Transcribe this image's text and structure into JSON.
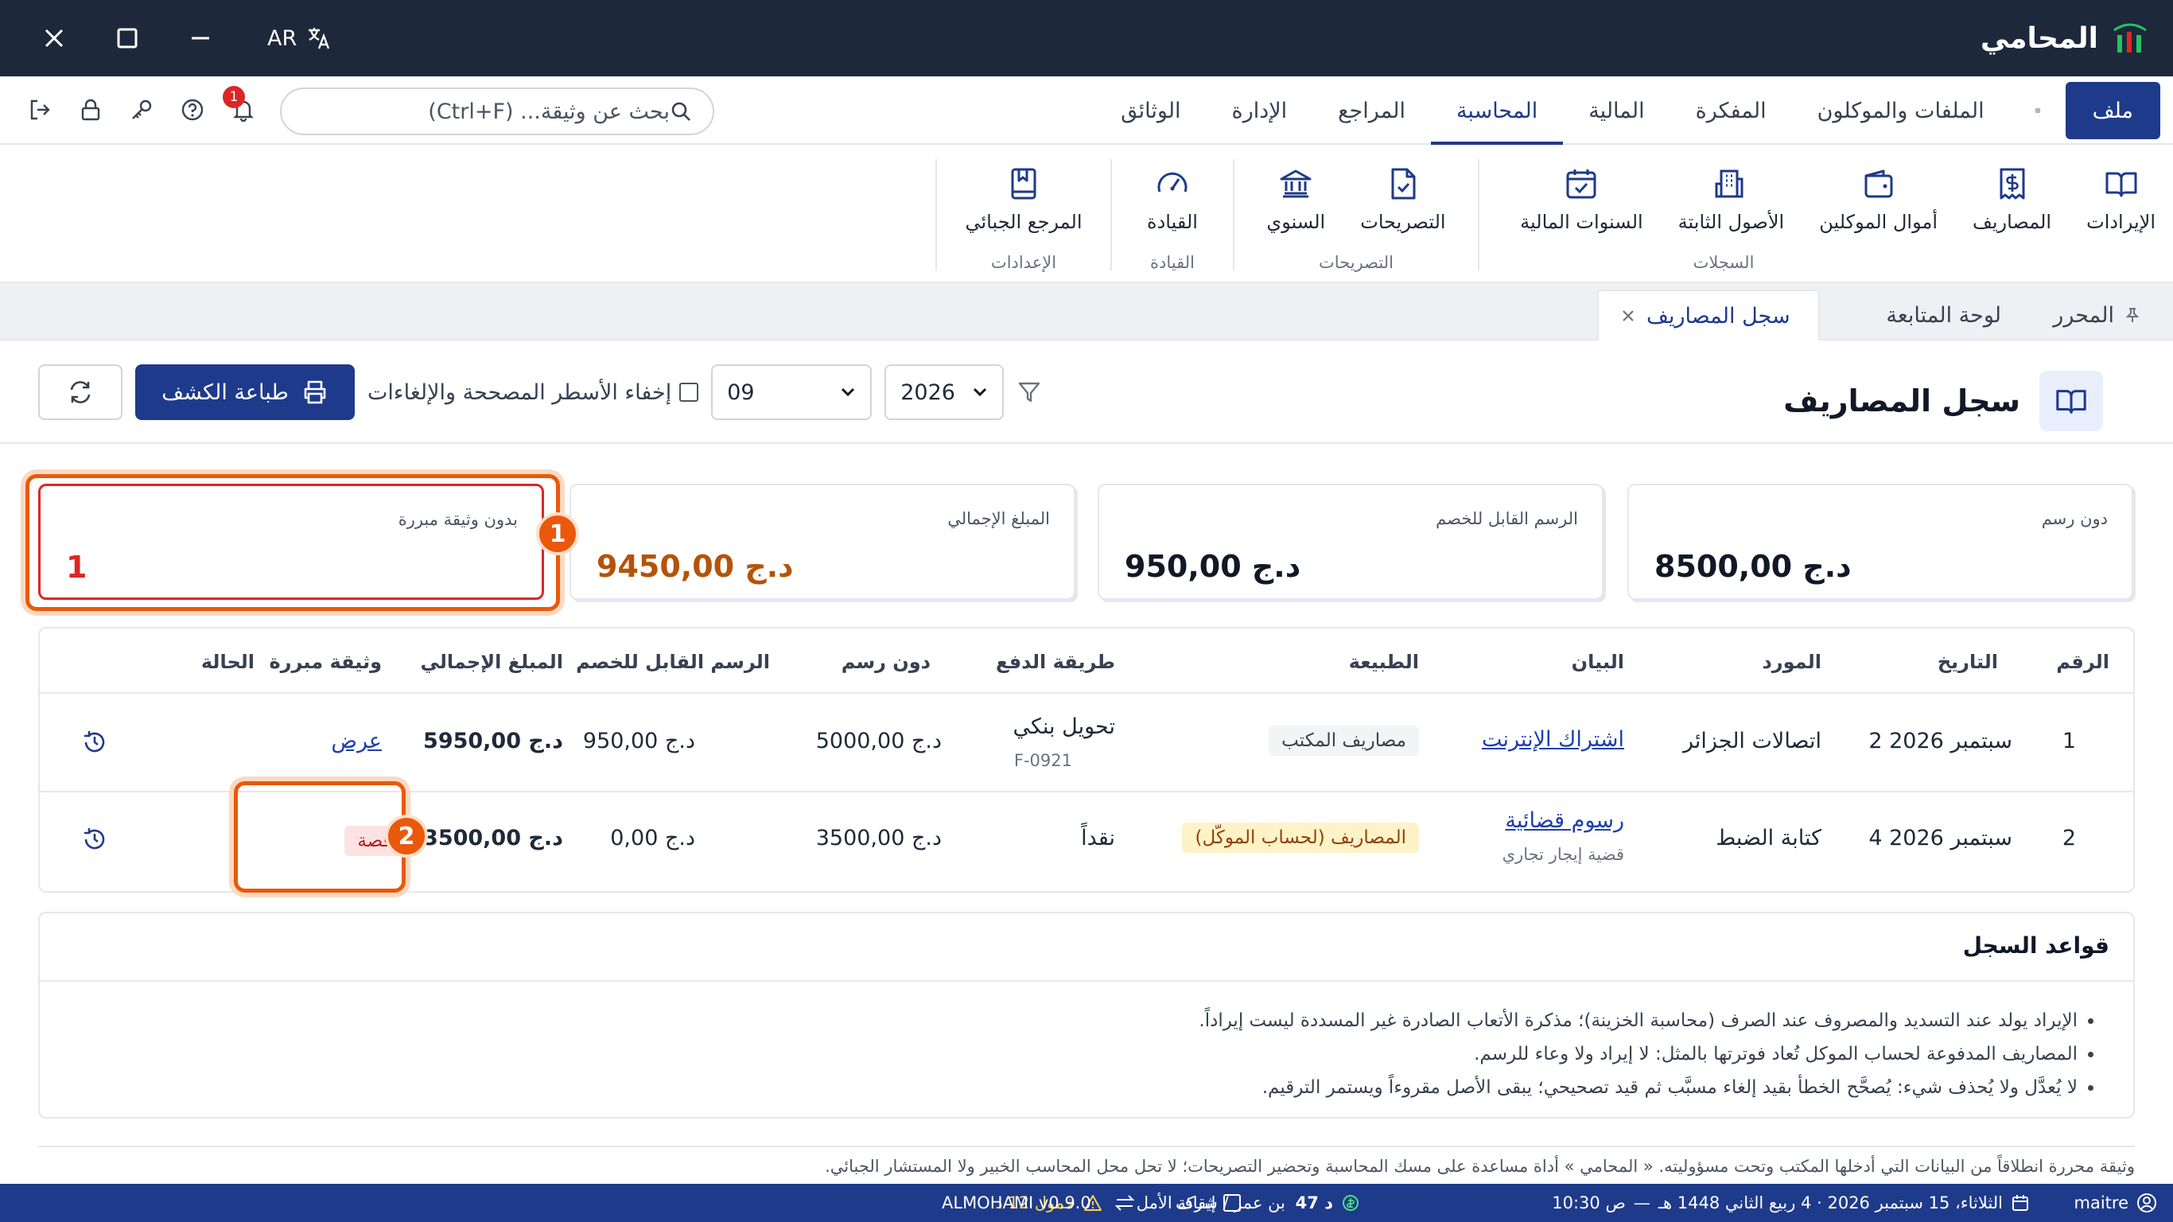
{
  "app": {
    "name": "المحامي",
    "version": "ALMOHAMI v0.9.0"
  },
  "window": {
    "lang_code": "AR"
  },
  "menu": {
    "file": "ملف",
    "tabs": [
      "الملفات والموكلون",
      "المفكرة",
      "المالية",
      "المحاسبة",
      "المراجع",
      "الإدارة",
      "الوثائق"
    ],
    "active_tab": "المحاسبة"
  },
  "search": {
    "placeholder": "بحث عن وثيقة... (Ctrl+F)"
  },
  "notifications": {
    "count": "1"
  },
  "ribbon": {
    "groups": [
      {
        "label": "السجلات",
        "items": [
          "الإيرادات",
          "المصاريف",
          "أموال الموكلين",
          "الأصول الثابتة",
          "السنوات المالية"
        ]
      },
      {
        "label": "التصريحات",
        "items": [
          "التصريحات",
          "السنوي"
        ]
      },
      {
        "label": "القيادة",
        "items": [
          "القيادة"
        ]
      },
      {
        "label": "الإعدادات",
        "items": [
          "المرجع الجبائي"
        ]
      }
    ]
  },
  "doc_tabs": {
    "editor": "المحرر",
    "dashboard": "لوحة المتابعة",
    "active": "سجل المصاريف"
  },
  "page": {
    "title": "سجل المصاريف",
    "year": "2026",
    "month": "09",
    "hide_corrected_label": "إخفاء الأسطر المصححة والإلغاءات",
    "print_label": "طباعة الكشف"
  },
  "stats": {
    "pre_tax": {
      "label": "دون رسم",
      "value": "8500,00 د.ج"
    },
    "deductible": {
      "label": "الرسم القابل للخصم",
      "value": "950,00 د.ج"
    },
    "total": {
      "label": "المبلغ الإجمالي",
      "value": "9450,00 د.ج"
    },
    "no_receipt": {
      "label": "بدون وثيقة مبررة",
      "value": "1"
    }
  },
  "markers": {
    "m1": "1",
    "m2": "2"
  },
  "table": {
    "headers": {
      "num": "الرقم",
      "date": "التاريخ",
      "vendor": "المورد",
      "desc": "البيان",
      "nature": "الطبيعة",
      "payment": "طريقة الدفع",
      "pre_tax": "دون رسم",
      "tax": "الرسم القابل للخصم",
      "total": "المبلغ الإجمالي",
      "receipt": "وثيقة مبررة",
      "status": "الحالة"
    },
    "rows": [
      {
        "num": "1",
        "date": "2 سبتمبر 2026",
        "vendor": "اتصالات الجزائر",
        "desc": "اشتراك الإنترنت",
        "desc_sub": "",
        "nature": "مصاريف المكتب",
        "payment": "تحويل بنكي",
        "payment_sub": "F-0921",
        "pre_tax": "5000,00 د.ج",
        "tax": "950,00 د.ج",
        "total": "5950,00 د.ج",
        "receipt": "عرض"
      },
      {
        "num": "2",
        "date": "4 سبتمبر 2026",
        "vendor": "كتابة الضبط",
        "desc": "رسوم قضائية",
        "desc_sub": "قضية إيجار تجاري",
        "nature": "المصاريف (لحساب الموكّل)",
        "payment": "نقداً",
        "payment_sub": "",
        "pre_tax": "3500,00 د.ج",
        "tax": "0,00 د.ج",
        "total": "3500,00 د.ج",
        "receipt": "ناقصة"
      }
    ]
  },
  "rules": {
    "title": "قواعد السجل",
    "items": [
      "الإيراد يولد عند التسديد والمصروف عند الصرف (محاسبة الخزينة)؛ مذكرة الأتعاب الصادرة غير المسددة ليست إيراداً.",
      "المصاريف المدفوعة لحساب الموكل تُعاد فوترتها بالمثل: لا إيراد ولا وعاء للرسم.",
      "لا يُعدَّل ولا يُحذف شيء: يُصحَّح الخطأ بقيد إلغاء مسبَّب ثم قيد تصحيحي؛ يبقى الأصل مقروءاً ويستمر الترقيم."
    ]
  },
  "disclaimer": "وثيقة محررة انطلاقاً من البيانات التي أدخلها المكتب وتحت مسؤوليته. « المحامي » أداة مساعدة على مسك المحاسبة وتحضير التصريحات؛ لا تحل محل المحاسب الخبير ولا المستشار الجبائي.",
  "status": {
    "user": "maitre",
    "date": "الثلاثاء، 15 سبتمبر 2026 · 4 ربيع الثاني 1448 هـ",
    "time": "10:30 ص",
    "credit": "47 د",
    "office": "بن عمر / شركة الأمل",
    "alert": "خمول 12 د",
    "pause": "إيقاف"
  },
  "colors": {
    "titlebar": "#1d283b",
    "accent": "#1e3a8a",
    "highlight": "#ea580c",
    "warn": "#dc2626",
    "amount_orange": "#b45309"
  }
}
